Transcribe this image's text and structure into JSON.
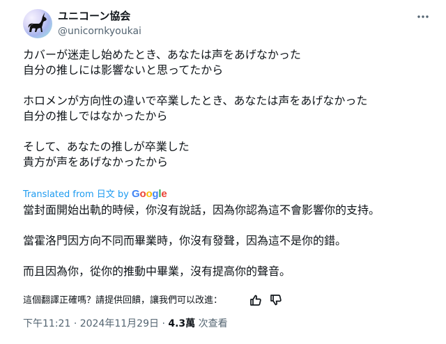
{
  "author": {
    "name": "ユニコーン協会",
    "handle": "@unicornkyoukai",
    "avatar_icon": "unicorn-silhouette"
  },
  "original_text": [
    [
      "カバーが迷走し始めたとき、あなたは声をあげなかった",
      "自分の推しには影響ないと思ってたから"
    ],
    [
      "ホロメンが方向性の違いで卒業したとき、あなたは声をあげなかった",
      "自分の推しではなかったから"
    ],
    [
      "そして、あなたの推しが卒業した",
      "貴方が声をあげなかったから"
    ]
  ],
  "translation_credit": {
    "prefix": "Translated from 日文 by",
    "provider": "Google"
  },
  "translated_text": [
    "當封面開始出軌的時候，你沒有說話，因為你認為這不會影響你的支持。",
    "當霍洛門因方向不同而畢業時，你沒有發聲，因為這不是你的錯。",
    "而且因為你，從你的推動中畢業，沒有提高你的聲音。"
  ],
  "rate_prompt": "這個翻譯正確嗎？請提供回饋，讓我們可以改進：",
  "meta": {
    "time": "下午11:21",
    "date": "2024年11月29日",
    "views": "4.3萬",
    "views_label": "次查看",
    "separator": "·"
  },
  "colors": {
    "link": "#1d9bf0",
    "secondary": "#536471",
    "text": "#0f1419"
  }
}
